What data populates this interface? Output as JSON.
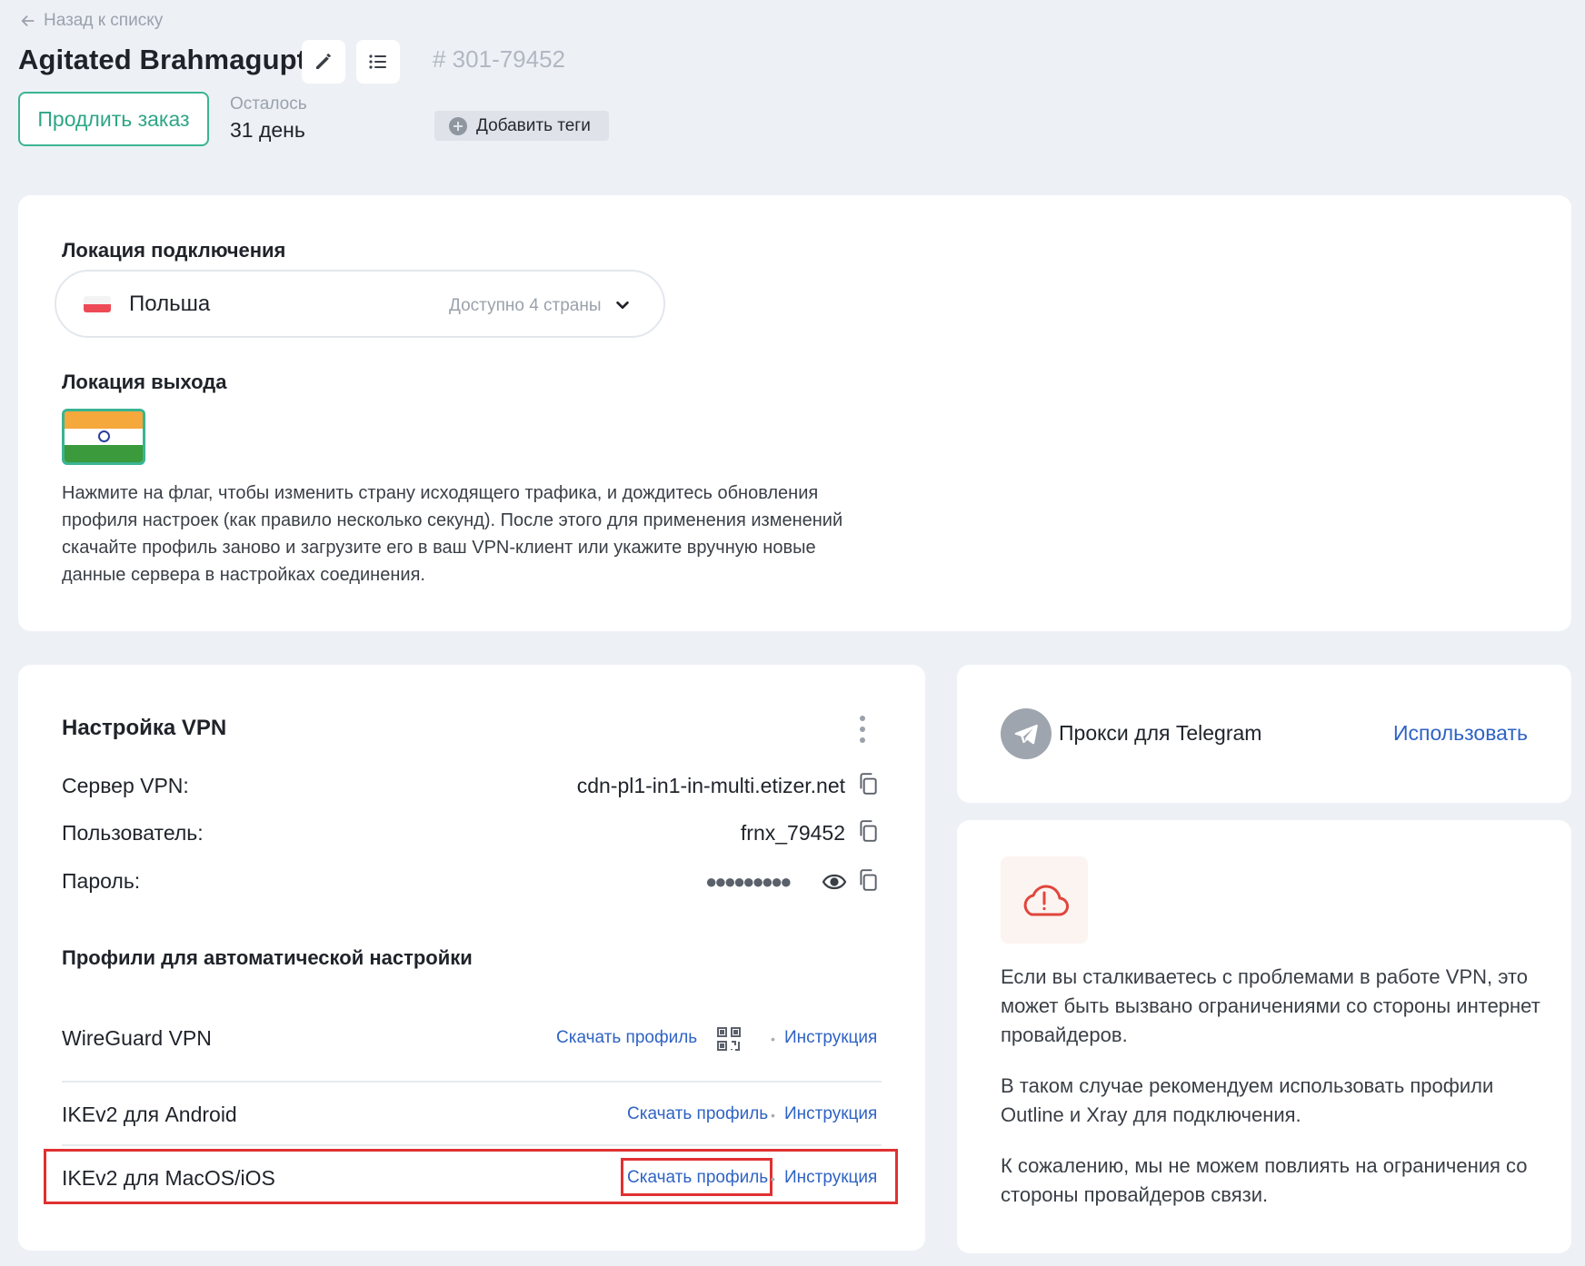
{
  "header": {
    "back_label": "Назад к списку",
    "title": "Agitated Brahmagupta",
    "order_number": "# 301-79452",
    "renew_label": "Продлить заказ",
    "remaining_label": "Осталось",
    "remaining_value": "31 день",
    "add_tags_label": "Добавить теги",
    "icons": [
      "pencil-icon",
      "list-icon",
      "plus-circle-icon",
      "arrow-left-icon"
    ]
  },
  "location": {
    "connection_title": "Локация подключения",
    "selected_country": "Польша",
    "available_text": "Доступно 4 страны",
    "exit_title": "Локация выхода",
    "hint": "Нажмите на флаг, чтобы изменить страну исходящего трафика, и дождитесь обновления профиля настроек (как правило несколько секунд). После этого для применения изменений скачайте профиль заново и загрузите его в ваш VPN-клиент или укажите вручную новые данные сервера в настройках соединения."
  },
  "vpn": {
    "title": "Настройка VPN",
    "server_label": "Сервер VPN:",
    "server_value": "cdn-pl1-in1-in-multi.etizer.net",
    "user_label": "Пользователь:",
    "user_value": "frnx_79452",
    "password_label": "Пароль:",
    "password_mask": "●●●●●●●●●",
    "profiles_title": "Профили для автоматической настройки",
    "profiles": [
      {
        "name": "WireGuard VPN",
        "download": "Скачать профиль",
        "guide": "Инструкция"
      },
      {
        "name": "IKEv2 для Android",
        "download": "Скачать профиль",
        "guide": "Инструкция"
      },
      {
        "name": "IKEv2 для MacOS/iOS",
        "download": "Скачать профиль",
        "guide": "Инструкция"
      }
    ],
    "bullet": "•"
  },
  "telegram": {
    "label": "Прокси для Telegram",
    "use_label": "Использовать"
  },
  "warning": {
    "p1": "Если вы сталкиваетесь с проблемами в работе VPN, это может быть вызвано ограничениями со стороны интернет провайдеров.",
    "p2": "В таком случае рекомендуем использовать профили Outline и Xray для подключения.",
    "p3": "К сожалению, мы не можем повлиять на ограничения со стороны провайдеров связи."
  },
  "colors": {
    "accent_green": "#3ab493",
    "link_blue": "#2f63c4",
    "highlight_red": "#e03131",
    "background": "#edf1f6"
  }
}
